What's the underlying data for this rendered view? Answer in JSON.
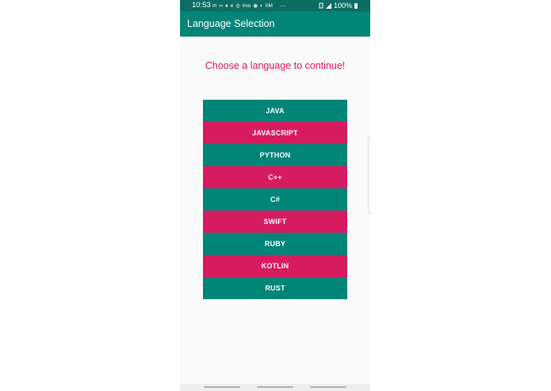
{
  "status_bar": {
    "time": "10:53",
    "notification_icons": [
      "m",
      "∞",
      "♠",
      "e",
      "◎",
      "imo",
      "◉",
      "◐",
      "0M"
    ],
    "more": "···",
    "battery": "100%"
  },
  "app_bar": {
    "title": "Language Selection"
  },
  "main": {
    "prompt": "Choose a language to continue!",
    "languages": [
      {
        "label": "JAVA",
        "color": "teal"
      },
      {
        "label": "JAVASCRIPT",
        "color": "pink"
      },
      {
        "label": "PYTHON",
        "color": "teal"
      },
      {
        "label": "C++",
        "color": "pink"
      },
      {
        "label": "C#",
        "color": "teal"
      },
      {
        "label": "SWIFT",
        "color": "pink"
      },
      {
        "label": "RUBY",
        "color": "teal"
      },
      {
        "label": "KOTLIN",
        "color": "pink"
      },
      {
        "label": "RUST",
        "color": "teal"
      }
    ]
  },
  "colors": {
    "primary": "#008577",
    "primary_dark": "#0d6d63",
    "accent": "#d81b60",
    "background": "#fafafa"
  }
}
